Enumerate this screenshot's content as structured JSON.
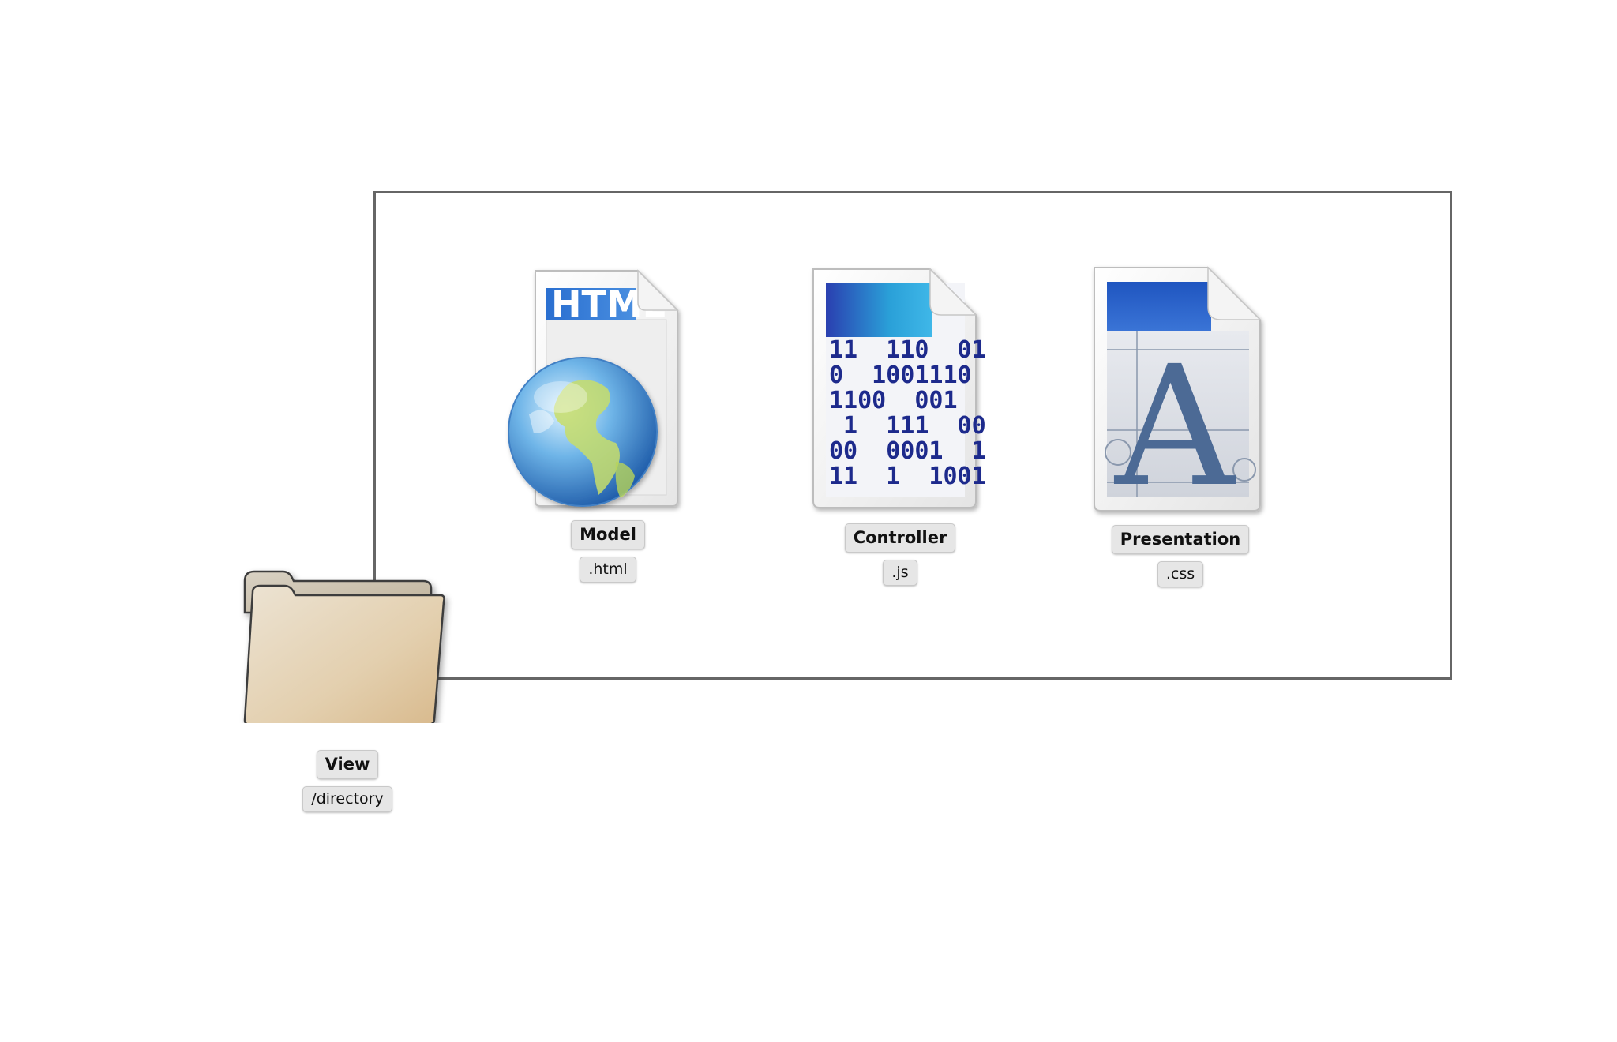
{
  "diagram": {
    "container": {
      "label": "View",
      "sublabel": "/directory",
      "icon": "folder-icon"
    },
    "files": [
      {
        "label": "Model",
        "sublabel": ".html",
        "icon": "html-file-icon",
        "icon_text": "HTML"
      },
      {
        "label": "Controller",
        "sublabel": ".js",
        "icon": "binary-file-icon",
        "icon_lines": [
          "11  110  01",
          "0  1001110",
          "1100  001",
          " 1  111  00",
          "00  0001  1",
          "11  1  1001"
        ]
      },
      {
        "label": "Presentation",
        "sublabel": ".css",
        "icon": "font-file-icon",
        "icon_text": "A"
      }
    ]
  },
  "colors": {
    "frame_border": "#666666",
    "tag_background": "#e6e6e6",
    "folder_tan": "#e3cfae",
    "doc_blue": "#2a62c9",
    "binary_text": "#1d2a8c",
    "glyph_slate": "#4c6a95"
  }
}
